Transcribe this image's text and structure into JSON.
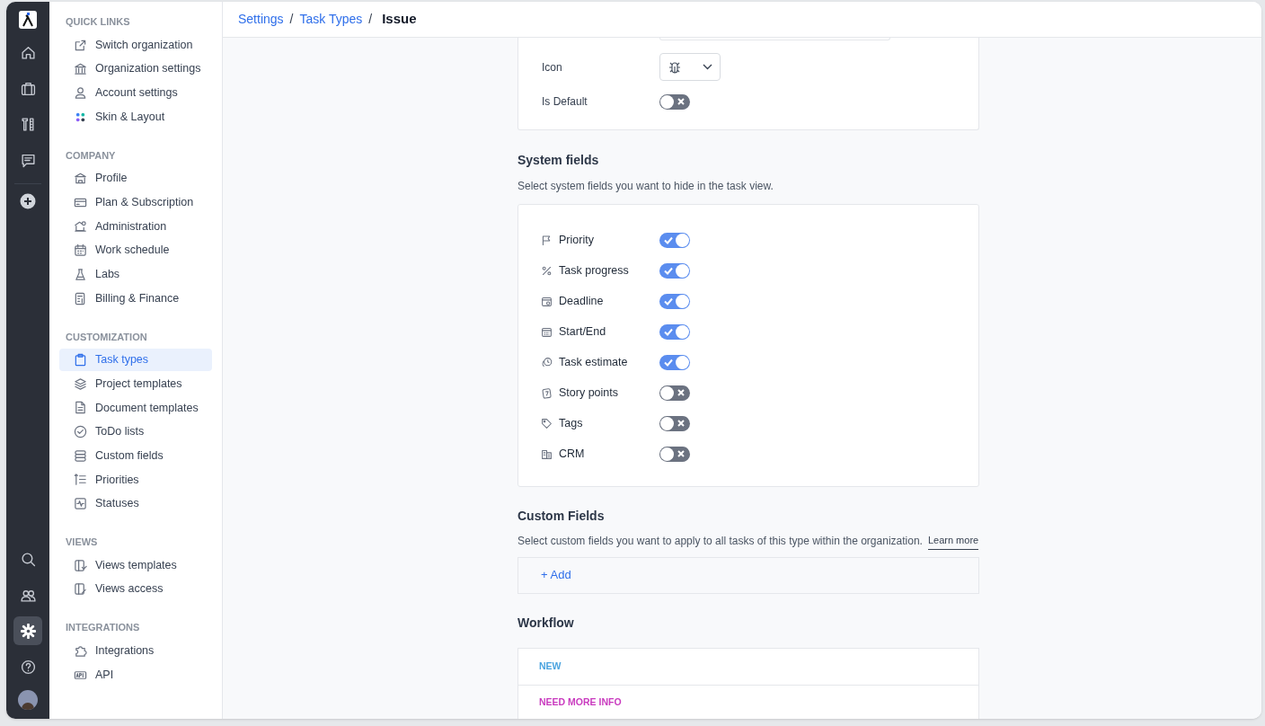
{
  "rail": {
    "top": [
      {
        "selected": false
      },
      {
        "selected": false
      },
      {
        "selected": false
      },
      {
        "selected": false
      }
    ],
    "bottom": [
      {
        "selected": false
      },
      {
        "selected": false
      },
      {
        "selected": true
      },
      {
        "selected": false
      }
    ]
  },
  "sidebar": {
    "sections": [
      {
        "title": "QUICK LINKS",
        "items": [
          {
            "label": "Switch organization",
            "selected": false
          },
          {
            "label": "Organization settings",
            "selected": false
          },
          {
            "label": "Account settings",
            "selected": false
          },
          {
            "label": "Skin & Layout",
            "selected": false
          }
        ]
      },
      {
        "title": "COMPANY",
        "items": [
          {
            "label": "Profile",
            "selected": false
          },
          {
            "label": "Plan & Subscription",
            "selected": false
          },
          {
            "label": "Administration",
            "selected": false
          },
          {
            "label": "Work schedule",
            "selected": false
          },
          {
            "label": "Labs",
            "selected": false
          },
          {
            "label": "Billing & Finance",
            "selected": false
          }
        ]
      },
      {
        "title": "CUSTOMIZATION",
        "items": [
          {
            "label": "Task types",
            "selected": true
          },
          {
            "label": "Project templates",
            "selected": false
          },
          {
            "label": "Document templates",
            "selected": false
          },
          {
            "label": "ToDo lists",
            "selected": false
          },
          {
            "label": "Custom fields",
            "selected": false
          },
          {
            "label": "Priorities",
            "selected": false
          },
          {
            "label": "Statuses",
            "selected": false
          }
        ]
      },
      {
        "title": "VIEWS",
        "items": [
          {
            "label": "Views templates",
            "selected": false
          },
          {
            "label": "Views access",
            "selected": false
          }
        ]
      },
      {
        "title": "INTEGRATIONS",
        "items": [
          {
            "label": "Integrations",
            "selected": false
          },
          {
            "label": "API",
            "selected": false
          }
        ]
      }
    ]
  },
  "breadcrumb": {
    "separator": "/",
    "items": [
      {
        "label": "Settings",
        "current": false
      },
      {
        "label": "Task Types",
        "current": false
      },
      {
        "label": "Issue",
        "current": true
      }
    ]
  },
  "general": {
    "icon_label": "Icon",
    "default_label": "Is Default",
    "is_default": false
  },
  "system_fields": {
    "title": "System fields",
    "description": "Select system fields you want to hide in the task view.",
    "fields": [
      {
        "label": "Priority",
        "on": true
      },
      {
        "label": "Task progress",
        "on": true
      },
      {
        "label": "Deadline",
        "on": true
      },
      {
        "label": "Start/End",
        "on": true
      },
      {
        "label": "Task estimate",
        "on": true
      },
      {
        "label": "Story points",
        "on": false
      },
      {
        "label": "Tags",
        "on": false
      },
      {
        "label": "CRM",
        "on": false
      }
    ]
  },
  "custom_fields": {
    "title": "Custom Fields",
    "description": "Select custom fields you want to apply to all tasks of this type within the organization.",
    "learn_more": "Learn more",
    "add": "+ Add"
  },
  "workflow": {
    "title": "Workflow",
    "statuses": [
      {
        "label": "NEW",
        "color": "#4aa3df"
      },
      {
        "label": "NEED MORE INFO",
        "color": "#c93bbf"
      }
    ]
  }
}
